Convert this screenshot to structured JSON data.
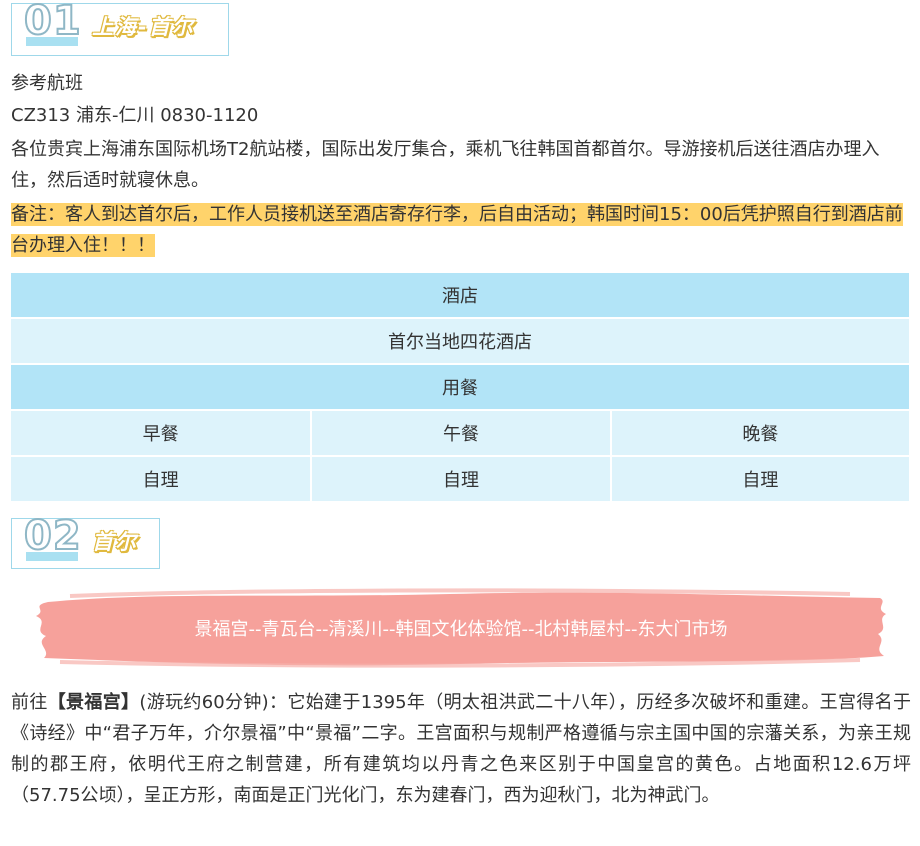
{
  "day1": {
    "num": "01",
    "title": "上海-首尔",
    "flight_label": "参考航班",
    "flight_info": "CZ313  浦东-仁川  0830-1120",
    "desc": "各位贵宾上海浦东国际机场T2航站楼，国际出发厅集合，乘机飞往韩国首都首尔。导游接机后送往酒店办理入住，然后适时就寝休息。",
    "note": "备注：客人到达首尔后，工作人员接机送至酒店寄存行李，后自由活动；韩国时间15：00后凭护照自行到酒店前台办理入住！！！"
  },
  "table": {
    "hotel_header": "酒店",
    "hotel_name": "首尔当地四花酒店",
    "meal_header": "用餐",
    "meals": [
      "早餐",
      "午餐",
      "晚餐"
    ],
    "meal_values": [
      "自理",
      "自理",
      "自理"
    ]
  },
  "day2": {
    "num": "02",
    "title": "首尔",
    "route": "景福宫--青瓦台--清溪川--韩国文化体验馆--北村韩屋村--东大门市场",
    "desc_prefix": "前往",
    "desc_highlight": "【景福宫】",
    "desc_rest": "(游玩约60分钟)：它始建于1395年（明太祖洪武二十八年），历经多次破坏和重建。王宫得名于《诗经》中“君子万年，介尔景福”中“景福”二字。王宫面积与规制严格遵循与宗主国中国的宗藩关系，为亲王规制的郡王府，依明代王府之制营建，所有建筑均以丹青之色来区别于中国皇宫的黄色。占地面积12.6万坪（57.75公顷），呈正方形，南面是正门光化门，东为建春门，西为迎秋门，北为神武门。"
  },
  "colors": {
    "badge_border": "#9fd8ea",
    "title_shadow": "#e0b93e",
    "highlight": "#ffd36b",
    "table_head": "#b2e4f7",
    "table_body": "#ddf3fb",
    "banner": "#f59c96"
  }
}
